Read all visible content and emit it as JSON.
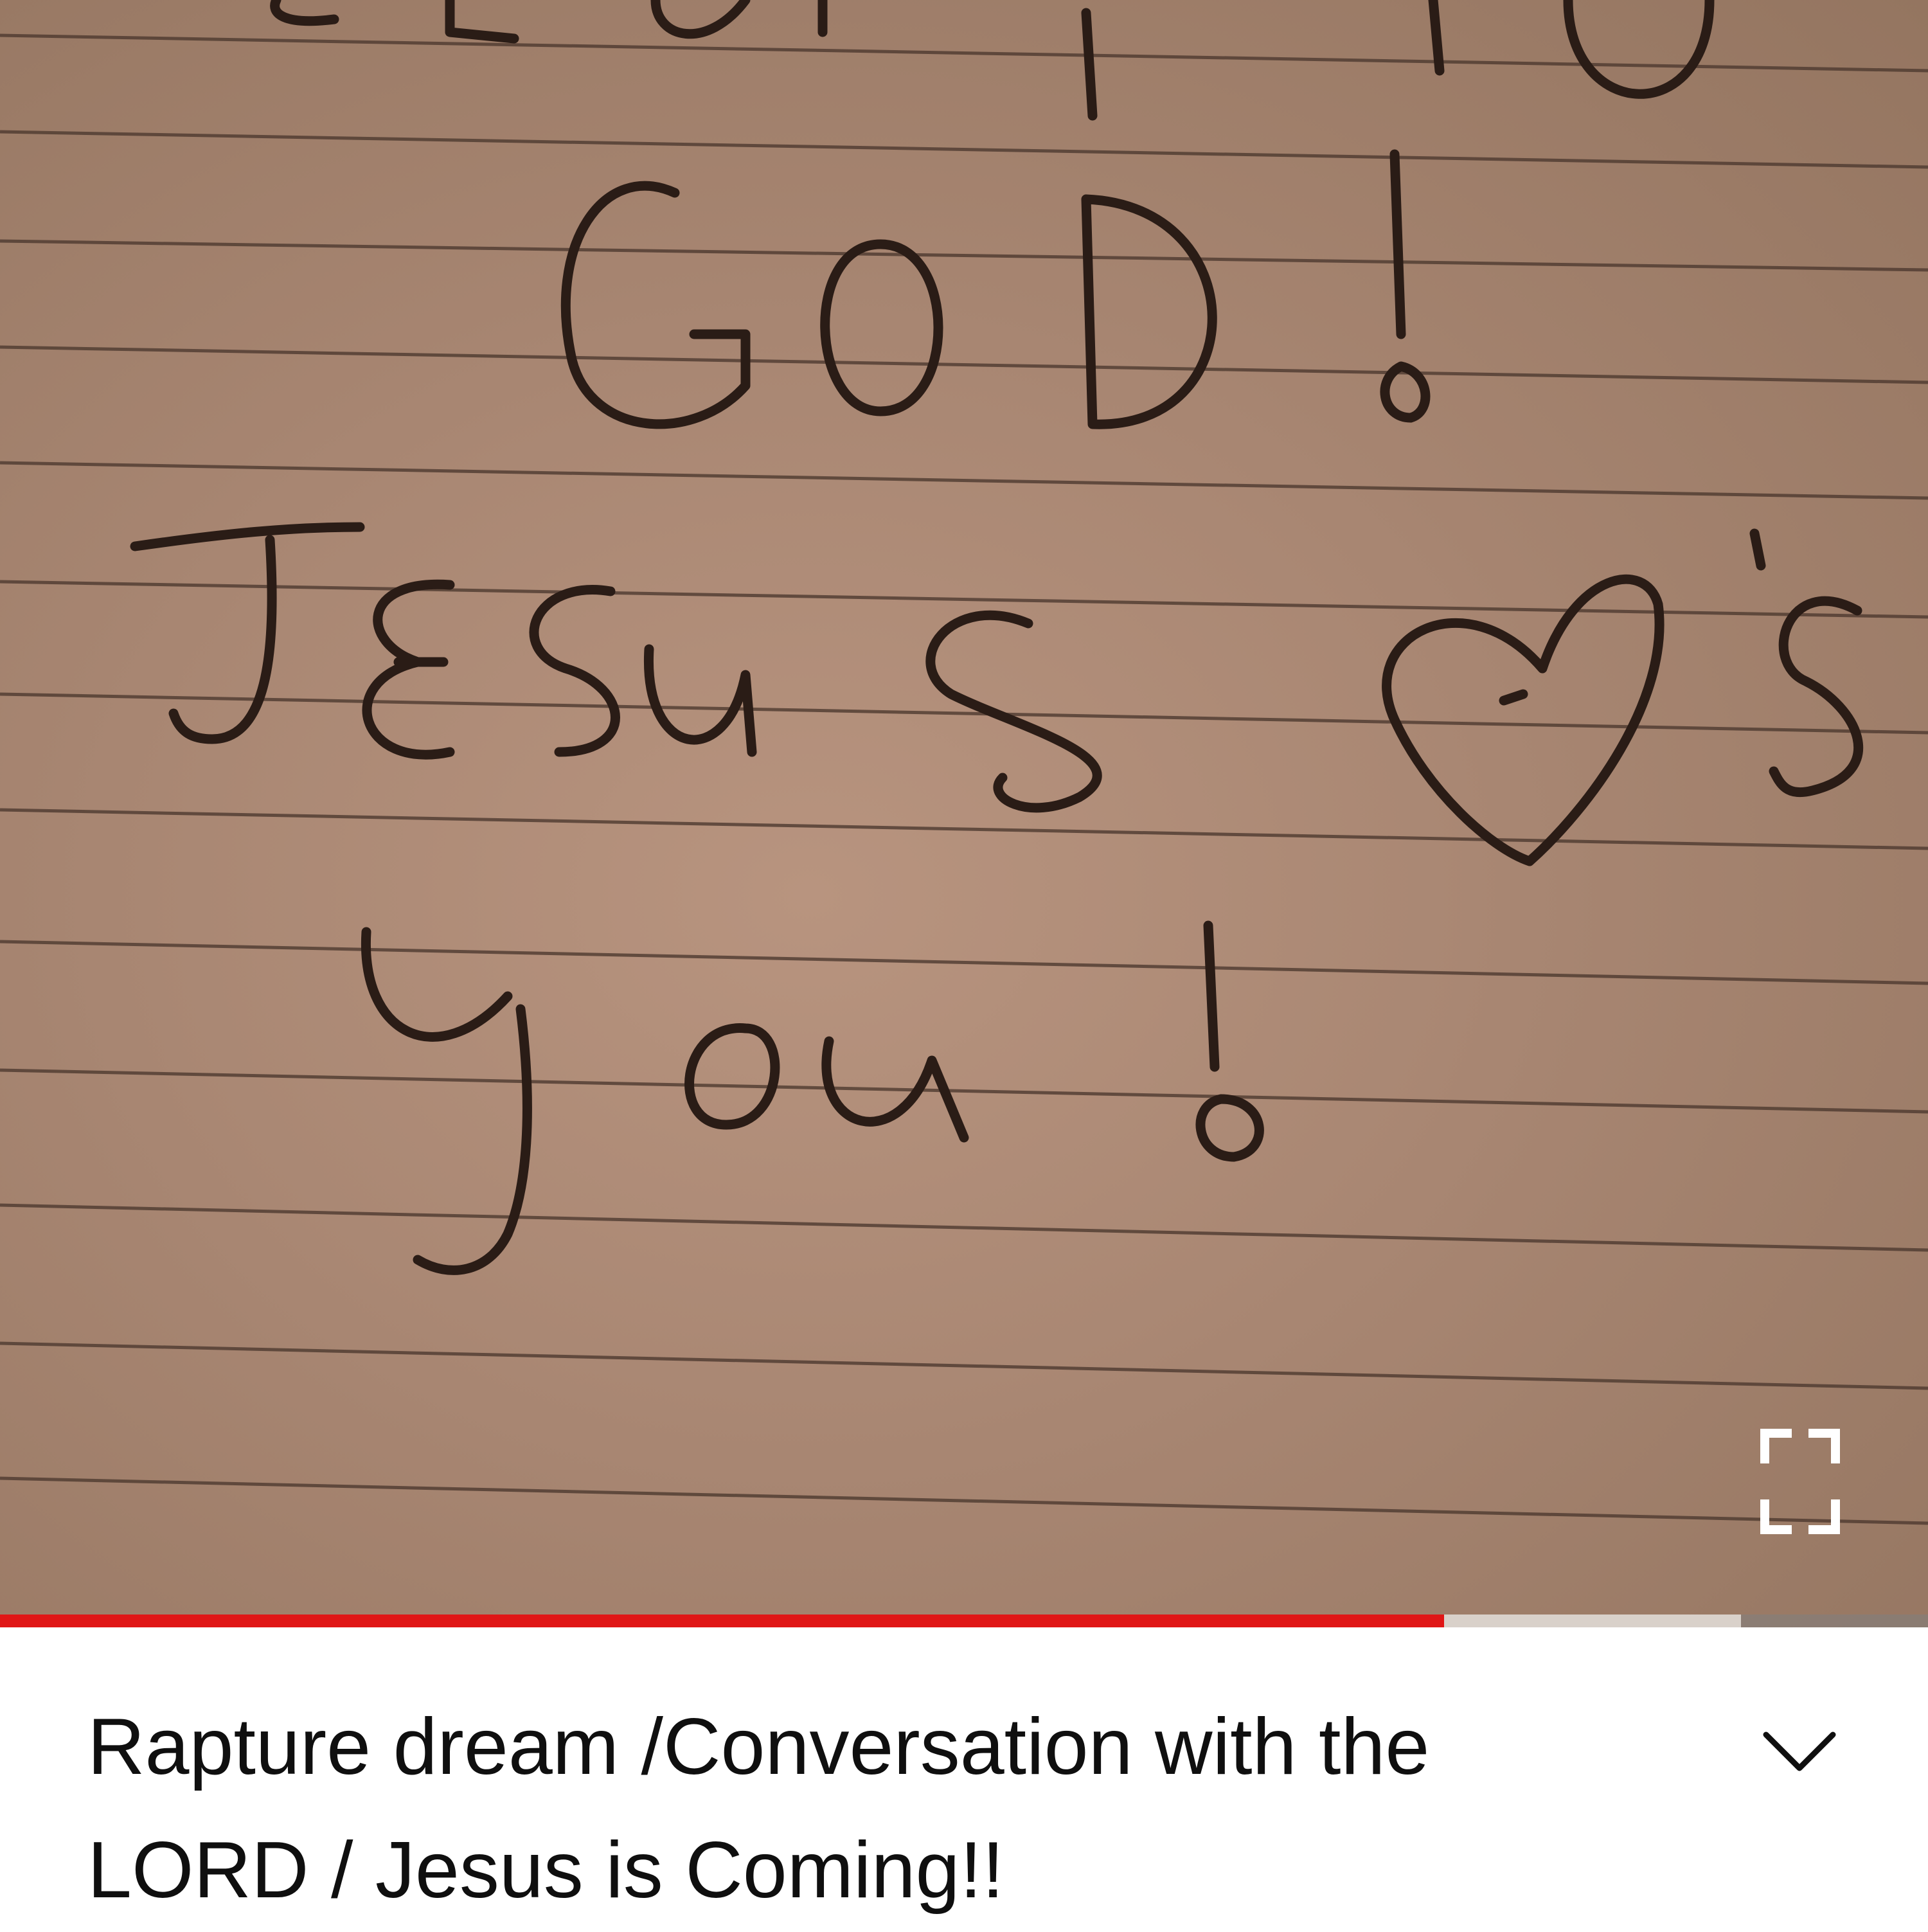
{
  "video": {
    "frame_text_lines": [
      "GLORY TO",
      "GOD!",
      "JESUS ♥'S",
      "you!"
    ],
    "progress": {
      "played_fraction": 0.749,
      "buffered_fraction": 0.903
    },
    "colors": {
      "progress_played": "#e01616",
      "progress_buffered": "#d9d1ca",
      "paper": "#a88672"
    },
    "fullscreen_icon": "fullscreen-icon"
  },
  "info": {
    "title": "Rapture dream /Conversation with the LORD / Jesus is Coming!!",
    "expand_icon": "chevron-down-icon"
  }
}
